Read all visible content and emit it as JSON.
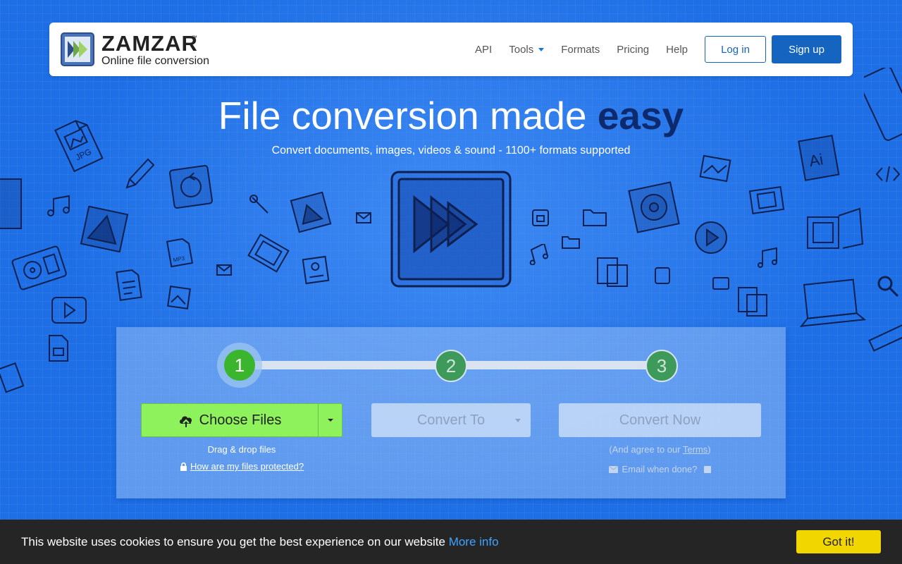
{
  "brand": {
    "name": "ZAMZAR",
    "trademark": "™",
    "tagline": "Online file conversion"
  },
  "nav": {
    "api": "API",
    "tools": "Tools",
    "formats": "Formats",
    "pricing": "Pricing",
    "help": "Help",
    "login": "Log in",
    "signup": "Sign up"
  },
  "hero": {
    "title_main": "File conversion made ",
    "title_em": "easy",
    "subtitle": "Convert documents, images, videos & sound - 1100+ formats supported"
  },
  "converter": {
    "steps": [
      "1",
      "2",
      "3"
    ],
    "choose_files": "Choose Files",
    "drag_drop": "Drag & drop files",
    "protect_link": "How are my files protected?",
    "convert_to": "Convert To",
    "convert_now": "Convert Now",
    "agree_prefix": "(And agree to our ",
    "terms_link": "Terms",
    "agree_suffix": ")",
    "email_label": "Email when done?"
  },
  "cookie": {
    "message": "This website uses cookies to ensure you get the best experience on our website ",
    "more_info": "More info",
    "accept": "Got it!"
  },
  "decor_labels": {
    "jpg": "JPG",
    "ai": "Ai",
    "mp3": "MP3"
  },
  "colors": {
    "background": "#1e6fe6",
    "primary": "#1565c0",
    "choose_green": "#8ef25c",
    "step_active": "#3bb52e",
    "cookie_button": "#f1d600",
    "title_emphasis": "#0d2a6e"
  }
}
